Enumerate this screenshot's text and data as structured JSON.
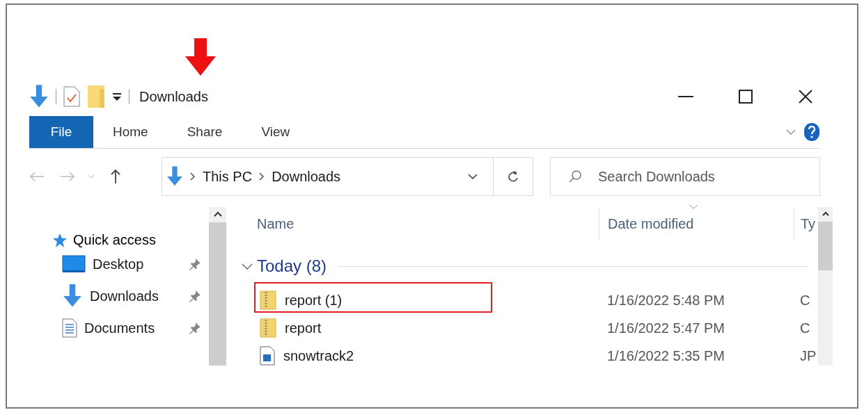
{
  "window": {
    "title": "Downloads"
  },
  "ribbon": {
    "tabs": [
      {
        "label": "File",
        "selected": true
      },
      {
        "label": "Home",
        "selected": false
      },
      {
        "label": "Share",
        "selected": false
      },
      {
        "label": "View",
        "selected": false
      }
    ]
  },
  "address_bar": {
    "path": [
      "This PC",
      "Downloads"
    ]
  },
  "search": {
    "placeholder": "Search Downloads"
  },
  "navigation": {
    "header": "Quick access",
    "items": [
      {
        "label": "Desktop",
        "kind": "desktop",
        "pinned": true
      },
      {
        "label": "Downloads",
        "kind": "downloads",
        "pinned": true
      },
      {
        "label": "Documents",
        "kind": "documents",
        "pinned": true
      }
    ]
  },
  "file_list": {
    "columns": [
      "Name",
      "Date modified",
      "Ty"
    ],
    "groups": [
      {
        "label": "Today (8)",
        "expanded": true,
        "rows": [
          {
            "name": "report (1)",
            "kind": "zip",
            "date": "1/16/2022 5:48 PM",
            "type": "C",
            "highlighted": true
          },
          {
            "name": "report",
            "kind": "zip",
            "date": "1/16/2022 5:47 PM",
            "type": "C",
            "highlighted": false
          },
          {
            "name": "snowtrack2",
            "kind": "image",
            "date": "1/16/2022 5:35 PM",
            "type": "JP",
            "highlighted": false
          }
        ]
      }
    ]
  }
}
